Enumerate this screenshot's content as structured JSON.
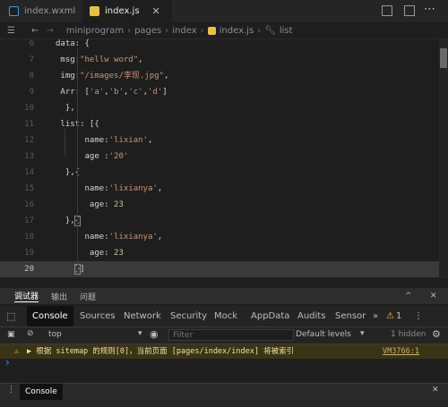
{
  "tabs": [
    {
      "label": "index.wxml",
      "type": "wxml",
      "active": false
    },
    {
      "label": "index.js",
      "type": "js",
      "active": true
    }
  ],
  "breadcrumb": [
    "miniprogram",
    "pages",
    "index",
    "index.js",
    "list"
  ],
  "code": [
    {
      "n": "6",
      "html": "data: {"
    },
    {
      "n": "7",
      "html": " msg:<span class=\"s\">\"hellw word\"</span>,"
    },
    {
      "n": "8",
      "html": " img:<span class=\"s\">\"/images/李现.jpg\"</span>,"
    },
    {
      "n": "9",
      "html": " Arr: [<span class=\"s\">'a'</span>,<span class=\"s\">'b'</span>,<span class=\"s\">'c'</span>,<span class=\"s\">'d'</span>]"
    },
    {
      "n": "10",
      "html": "  },"
    },
    {
      "n": "11",
      "html": " list: [{"
    },
    {
      "n": "12",
      "html": "      name:<span class=\"s\">'lixian'</span>,"
    },
    {
      "n": "13",
      "html": "      age :<span class=\"s\">'20'</span>"
    },
    {
      "n": "14",
      "html": "  },{"
    },
    {
      "n": "15",
      "html": "      name:<span class=\"s\">'lixianya'</span>,"
    },
    {
      "n": "16",
      "html": "       age: <span class=\"n\">23</span>"
    },
    {
      "n": "17",
      "html": "  },<span class=\"hb\">{</span>"
    },
    {
      "n": "18",
      "html": "      name:<span class=\"s\">'lixianya'</span>,"
    },
    {
      "n": "19",
      "html": "       age: <span class=\"n\">23</span>"
    },
    {
      "n": "20",
      "html": "    <span class=\"hb\">}</span>]"
    }
  ],
  "devtools": {
    "top_tabs": [
      "调试器",
      "输出",
      "问题"
    ],
    "tabs": [
      "Console",
      "Sources",
      "Network",
      "Security",
      "Mock",
      "AppData",
      "Audits",
      "Sensor"
    ],
    "more": "»",
    "warn_count": "1",
    "context": "top",
    "filter_placeholder": "Filter",
    "levels": "Default levels",
    "hidden": "1 hidden",
    "warning_text": "▶ 根据 sitemap 的规则[0]，当前页面 [pages/index/index] 将被索引",
    "warning_source": "VM3766:1",
    "prompt": "›",
    "drawer_tab": "Console"
  },
  "colors": {
    "accent": "#e8c335",
    "warning_bg": "#3a3416",
    "editor_bg": "#1e1e1e"
  }
}
